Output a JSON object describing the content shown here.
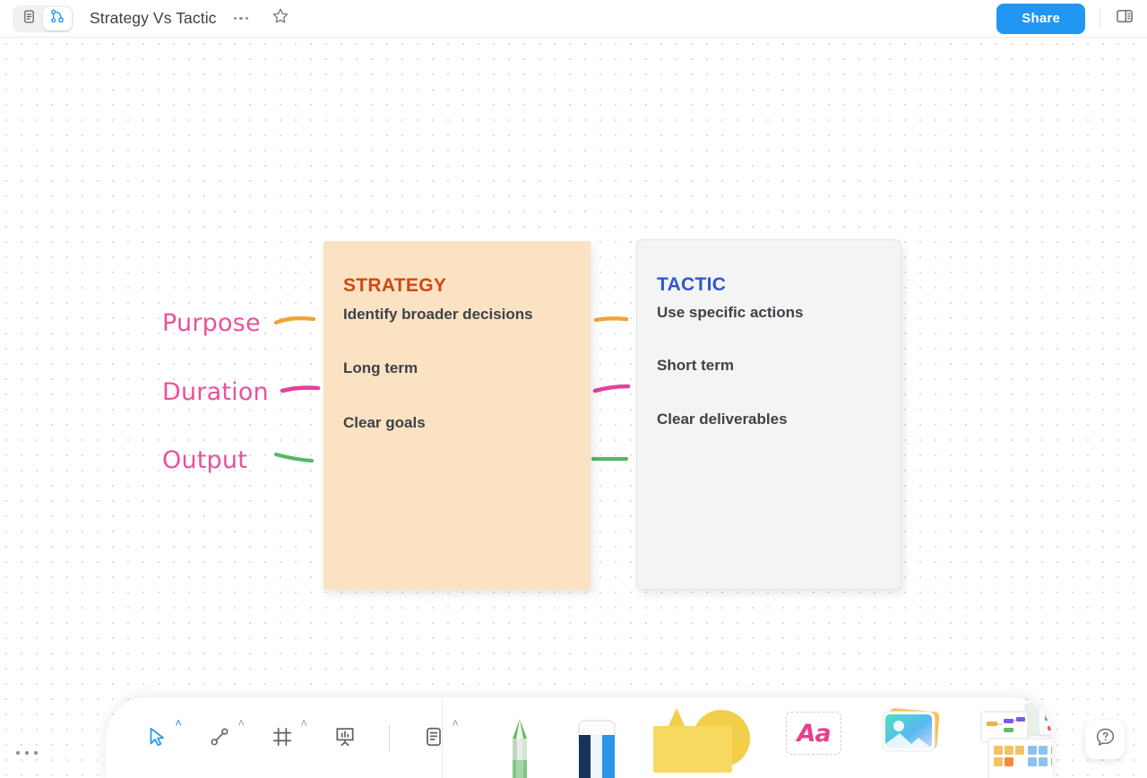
{
  "header": {
    "title": "Strategy Vs Tactic",
    "mode_doc_icon": "document-icon",
    "mode_board_icon": "flow-graph-icon",
    "more_icon": "more-dots-icon",
    "favorite_icon": "star-icon",
    "share_label": "Share",
    "panel_icon": "right-panel-icon"
  },
  "board": {
    "row_labels": [
      {
        "text": "Purpose",
        "color": "#e8529b",
        "line_color": "#f0a33a"
      },
      {
        "text": "Duration",
        "color": "#e8529b",
        "line_color": "#e0449a"
      },
      {
        "text": "Output",
        "color": "#e8529b",
        "line_color": "#57b668"
      }
    ],
    "cards": [
      {
        "title": "STRATEGY",
        "title_color": "#cc4a14",
        "bg_color": "#fbe2c2",
        "items": [
          "Identify broader decisions",
          "Long term",
          "Clear goals"
        ]
      },
      {
        "title": "TACTIC",
        "title_color": "#2f57cd",
        "bg_color": "#f4f4f4",
        "items": [
          "Use specific actions",
          "Short term",
          "Clear deliverables"
        ]
      }
    ]
  },
  "toolbar": {
    "tools": [
      {
        "name": "select-cursor-tool",
        "caret": "˄",
        "selected": true
      },
      {
        "name": "connector-tool",
        "caret": "˄",
        "selected": false
      },
      {
        "name": "frame-tool",
        "caret": "˄",
        "selected": false
      },
      {
        "name": "presentation-tool",
        "caret": "",
        "selected": false
      },
      {
        "name": "note-tool",
        "caret": "˄",
        "selected": false
      }
    ],
    "big_tools": [
      {
        "name": "pencil-tool"
      },
      {
        "name": "eraser-tool"
      },
      {
        "name": "shapes-tool"
      },
      {
        "name": "text-tool",
        "label": "Aa"
      },
      {
        "name": "media-tool"
      },
      {
        "name": "template-tool"
      }
    ]
  },
  "overlays": {
    "canvas_menu_icon": "more-dots-icon",
    "help_icon": "help-question-icon"
  }
}
